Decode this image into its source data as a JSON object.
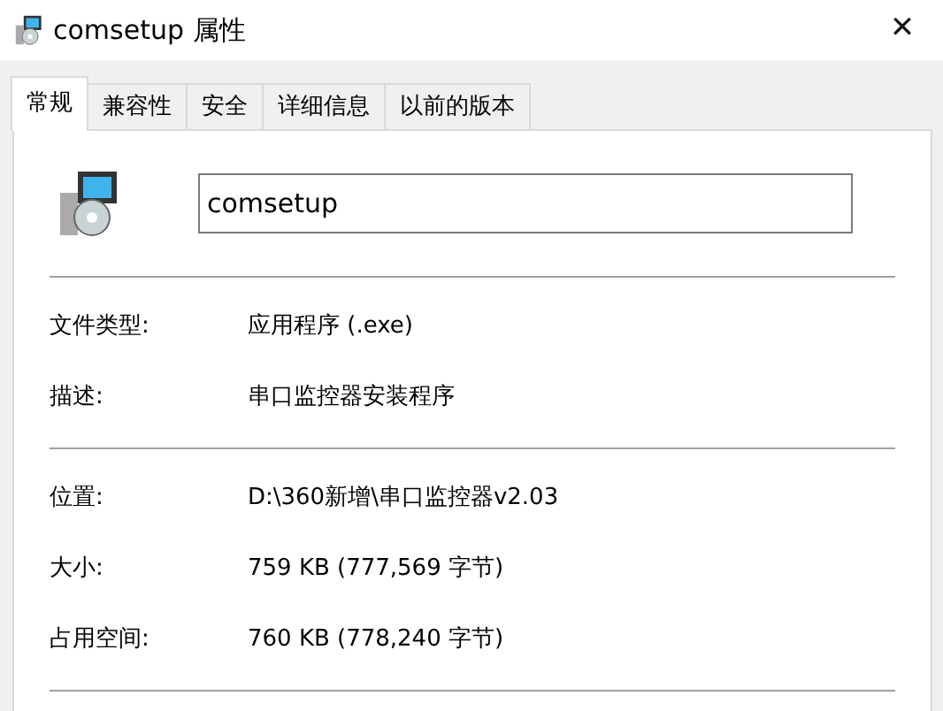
{
  "window": {
    "title": "comsetup 属性",
    "close": "✕"
  },
  "tabs": [
    {
      "label": "常规",
      "selected": true
    },
    {
      "label": "兼容性",
      "selected": false
    },
    {
      "label": "安全",
      "selected": false
    },
    {
      "label": "详细信息",
      "selected": false
    },
    {
      "label": "以前的版本",
      "selected": false
    }
  ],
  "file_name": {
    "value": "comsetup"
  },
  "sections": [
    {
      "rows": [
        {
          "label": "文件类型:",
          "value": "应用程序 (.exe)"
        },
        {
          "label": "描述:",
          "value": "串口监控器安装程序"
        }
      ]
    },
    {
      "rows": [
        {
          "label": "位置:",
          "value": "D:\\360新增\\串口监控器v2.03"
        },
        {
          "label": "大小:",
          "value": "759 KB (777,569 字节)"
        },
        {
          "label": "占用空间:",
          "value": "760 KB (778,240 字节)"
        }
      ]
    }
  ]
}
